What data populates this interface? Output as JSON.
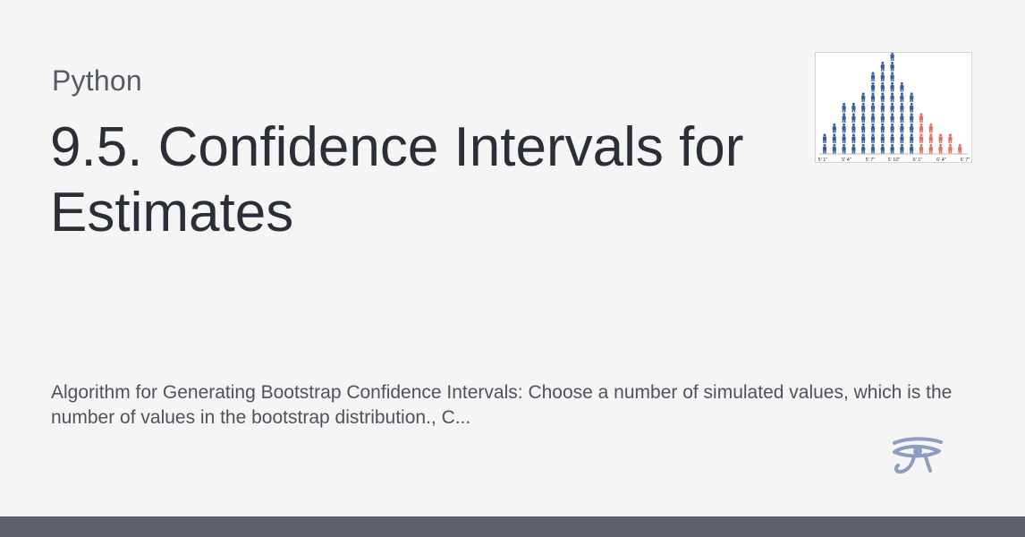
{
  "card": {
    "category": "Python",
    "title": "9.5. Confidence Intervals for Estimates",
    "description": "Algorithm for Generating Bootstrap Confidence Intervals: Choose a number of simulated values, which is the number of values in the bootstrap distribution., C...",
    "thumbnail": {
      "axis_labels": [
        "5' 1\"",
        "5' 4\"",
        "5' 7\"",
        "5' 10\"",
        "6' 1\"",
        "6' 4\"",
        "6' 7\""
      ],
      "column_counts": [
        2,
        3,
        5,
        5,
        6,
        8,
        9,
        10,
        7,
        6,
        4,
        3,
        2,
        2,
        1
      ],
      "highlight_from_column": 10,
      "colors": {
        "figure_main": "#3b5d9a",
        "figure_highlight": "#e06f64"
      }
    },
    "logo_icon": "eye-of-horus-icon",
    "colors": {
      "background": "#f5f5f5",
      "footer_bar": "#5d626d",
      "logo": "#8e9cc4"
    }
  }
}
